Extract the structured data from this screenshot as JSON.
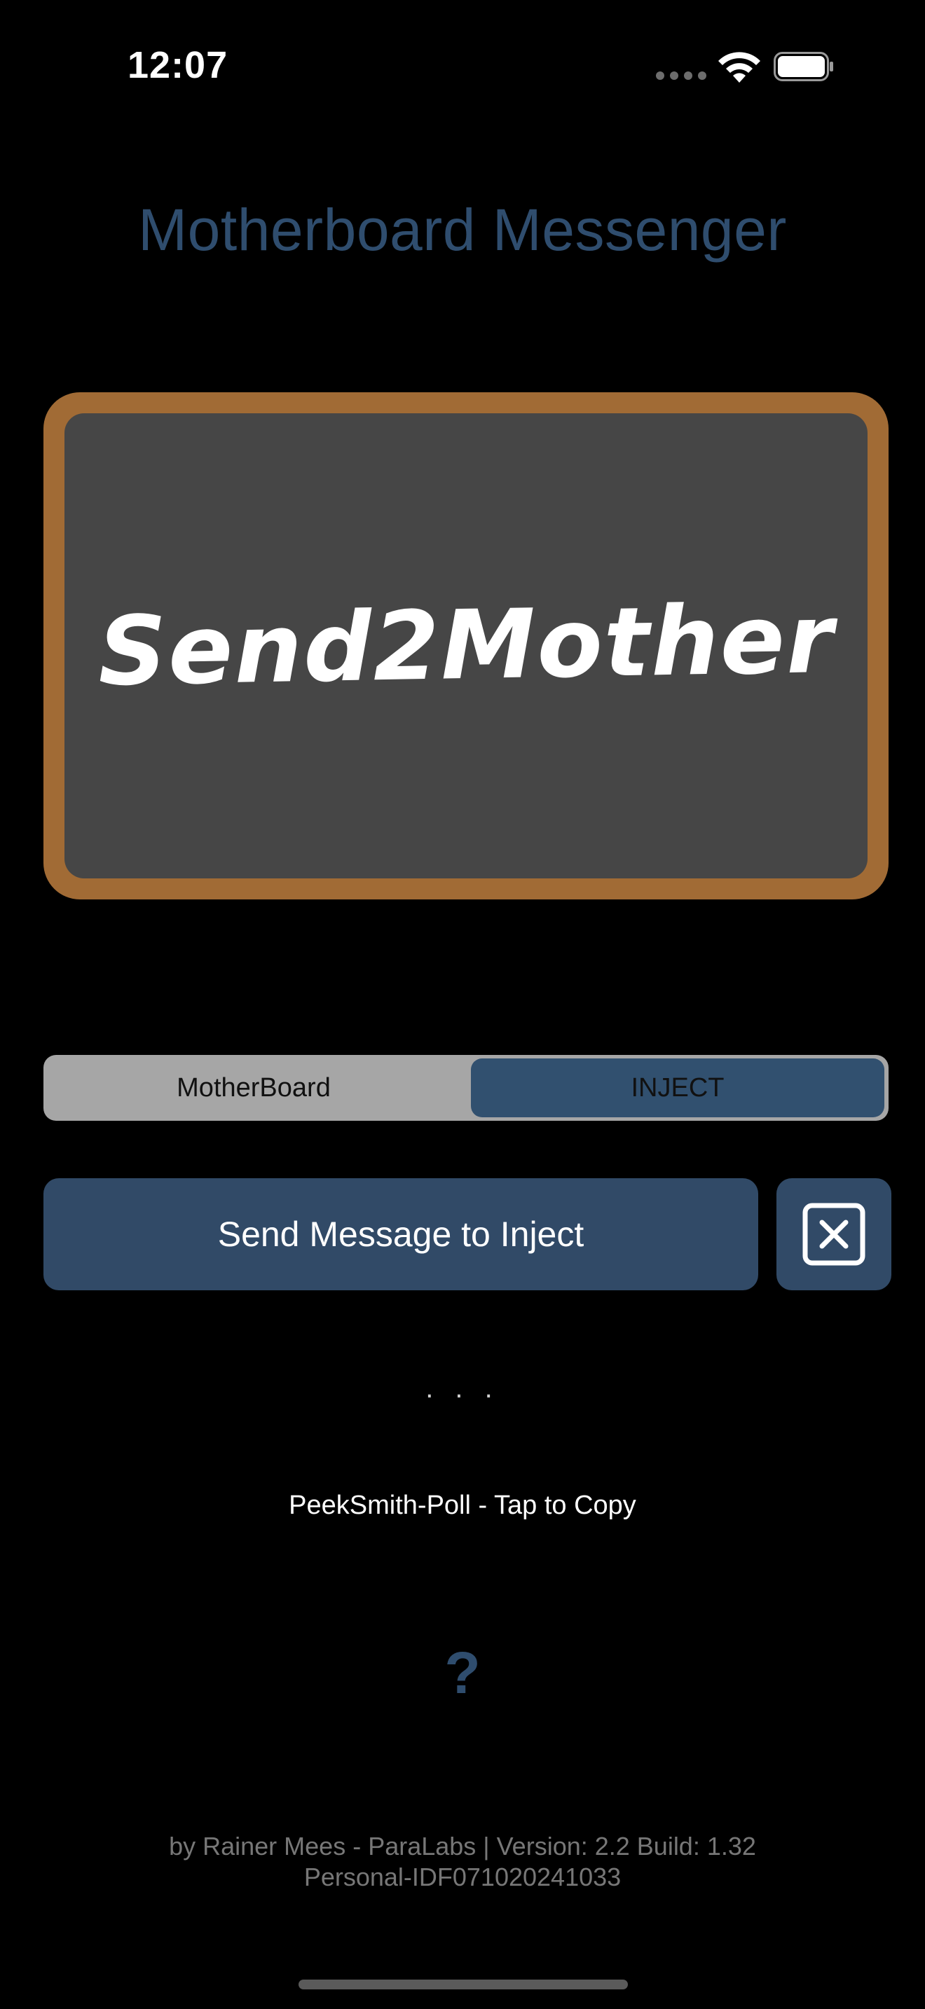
{
  "status_bar": {
    "time": "12:07"
  },
  "app": {
    "title": "Motherboard Messenger",
    "title_color": "#2f4d6e"
  },
  "board": {
    "text": "Send2Mother",
    "frame_color": "#a16b35",
    "surface_color": "#464646"
  },
  "segmented": {
    "options": [
      "MotherBoard",
      "INJECT"
    ],
    "selected": "INJECT"
  },
  "actions": {
    "send_label": "Send Message to Inject",
    "clear_icon": "close-box-icon",
    "button_color": "#314a67"
  },
  "status": {
    "ellipsis": ". . .",
    "copy_label": "PeekSmith-Poll - Tap to Copy"
  },
  "help": {
    "label": "?"
  },
  "footer": {
    "line1": "by Rainer Mees - ParaLabs | Version: 2.2 Build: 1.32",
    "line2": "Personal-IDF071020241033"
  }
}
